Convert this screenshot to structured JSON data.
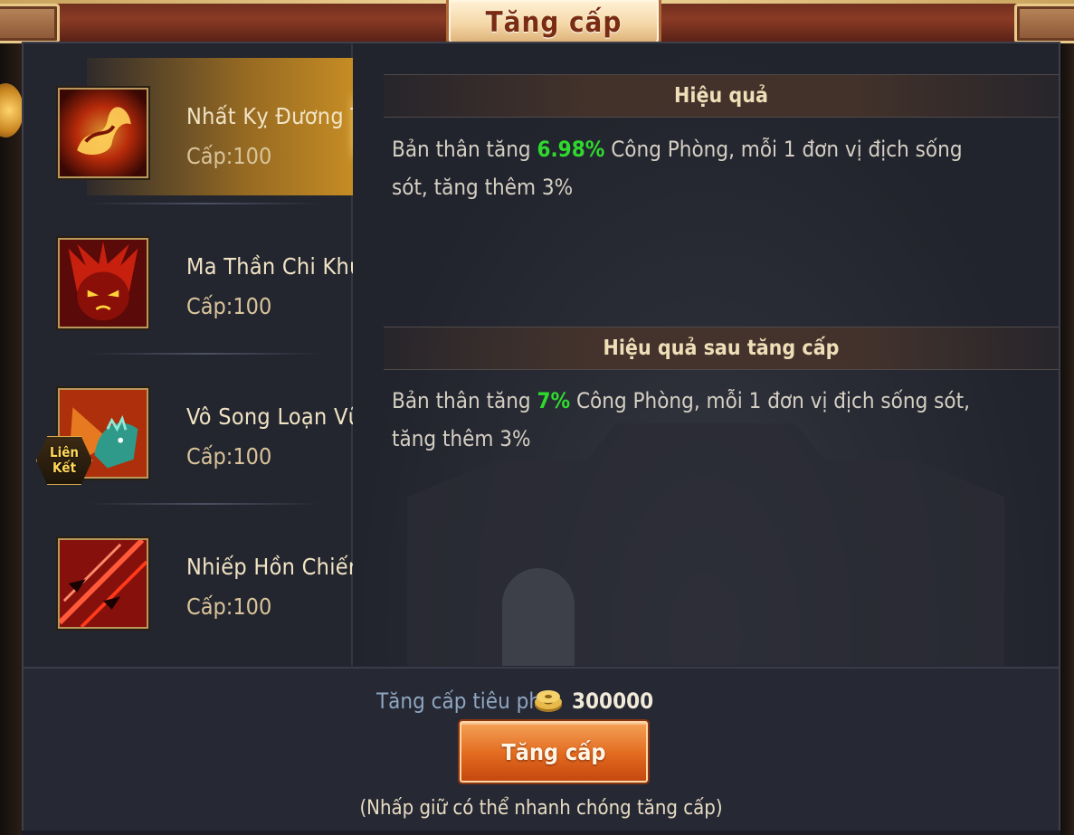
{
  "window": {
    "title": "Tăng cấp"
  },
  "skills": [
    {
      "name": "Nhất Kỵ Đương Thiên",
      "level": "Cấp:100",
      "selected": true,
      "icon": "flame-dragon-icon"
    },
    {
      "name": "Ma Thần Chi Khu",
      "level": "Cấp:100",
      "selected": false,
      "icon": "demon-face-icon"
    },
    {
      "name": "Vô Song Loạn Vũ",
      "level": "Cấp:100",
      "selected": false,
      "icon": "beast-icon",
      "badge": [
        "Liên",
        "Kết"
      ]
    },
    {
      "name": "Nhiếp Hồn Chiến Kích",
      "level": "Cấp:100",
      "selected": false,
      "icon": "red-slash-icon"
    }
  ],
  "effect": {
    "header": "Hiệu quả",
    "pre": "Bản thân tăng ",
    "value": "6.98%",
    "post": " Công Phòng, mỗi 1 đơn vị địch sống sót, tăng thêm 3%"
  },
  "next_effect": {
    "header": "Hiệu quả sau tăng cấp",
    "pre": "Bản thân tăng ",
    "value": "7%",
    "post": " Công Phòng, mỗi 1 đơn vị địch sống sót, tăng thêm 3%"
  },
  "cost": {
    "label": "Tăng cấp tiêu phí",
    "value": "300000",
    "icon": "coin-icon"
  },
  "button": {
    "label": "Tăng cấp"
  },
  "hint": "(Nhấp giữ có thể nhanh chóng tăng cấp)",
  "colors": {
    "highlight": "#2fd82f",
    "gold": "#ffd36a",
    "button": "#e26a1f"
  }
}
